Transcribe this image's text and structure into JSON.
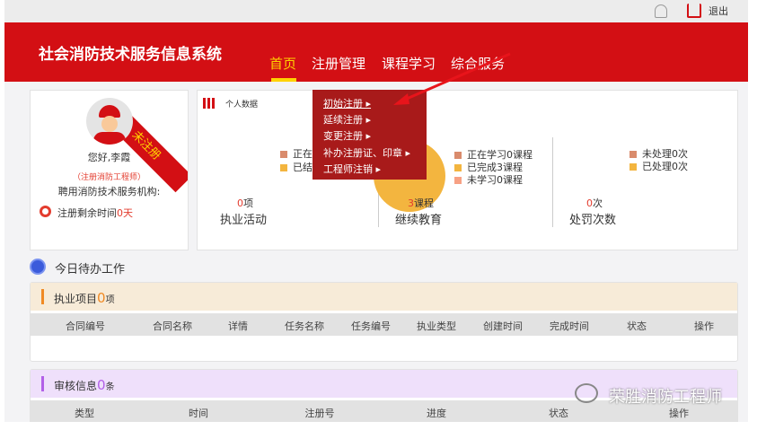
{
  "header": {
    "bell_icon": "bell-icon",
    "logout_label": "退出",
    "system_title": "社会消防技术服务信息系统",
    "nav": [
      {
        "label": "首页",
        "active": true
      },
      {
        "label": "注册管理"
      },
      {
        "label": "课程学习"
      },
      {
        "label": "综合服务"
      }
    ]
  },
  "colors": {
    "brand_red": "#d30f14",
    "active_nav": "#ffd200",
    "menu_bg": "#a81a1a",
    "accent_red": "#e33c2e"
  },
  "dropdown": {
    "items": [
      "初始注册",
      "延续注册",
      "变更注册",
      "补办注册证、印章",
      "工程师注销"
    ]
  },
  "profile": {
    "ribbon": "未注册",
    "greeting": "您好,李霞",
    "role": "（注册消防工程师）",
    "org_label": "聘用消防技术服务机构:",
    "remaining_label": "注册剩余时间",
    "remaining_value": "0天"
  },
  "stats": {
    "title": "个人数据",
    "practice": {
      "count": "0",
      "unit": "项",
      "label": "执业活动",
      "legend": [
        "正在",
        "已结"
      ]
    },
    "education": {
      "count": "3",
      "unit": "课程",
      "label": "继续教育",
      "legend": [
        "正在学习0课程",
        "已完成3课程",
        "未学习0课程"
      ],
      "legend_colors": [
        "#d98b6c",
        "#f3b53f",
        "#f7a184"
      ],
      "completed_fraction": 1
    },
    "penalty": {
      "count": "0",
      "unit": "次",
      "label": "处罚次数",
      "legend": [
        "未处理0次",
        "已处理0次"
      ]
    }
  },
  "todo": {
    "title": "今日待办工作",
    "practice_panel": {
      "title": "执业项目",
      "count": "0",
      "unit": "项",
      "columns": [
        "合同编号",
        "合同名称",
        "详情",
        "任务名称",
        "任务编号",
        "执业类型",
        "创建时间",
        "完成时间",
        "状态",
        "操作"
      ]
    },
    "review_panel": {
      "title": "审核信息",
      "count": "0",
      "unit": "条",
      "columns": [
        "类型",
        "时间",
        "注册号",
        "进度",
        "状态",
        "操作"
      ]
    }
  },
  "watermark": "荣胜消防工程师"
}
